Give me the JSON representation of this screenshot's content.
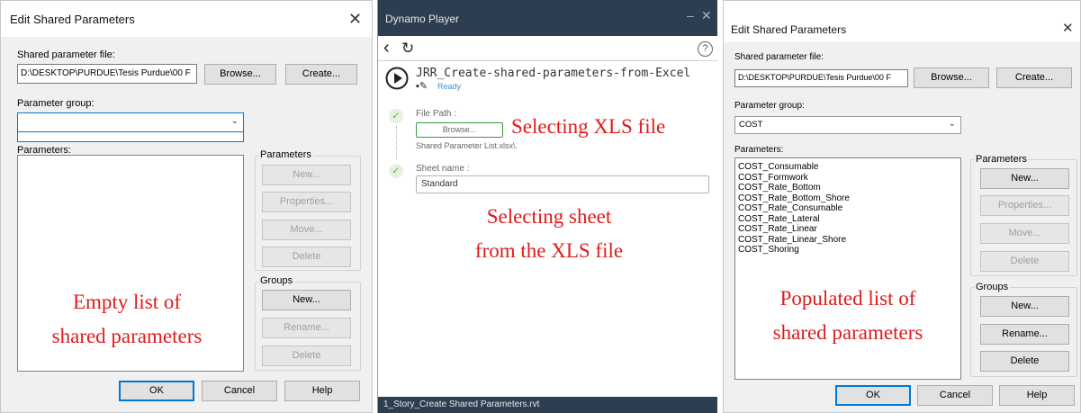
{
  "left_dialog": {
    "title": "Edit Shared Parameters",
    "shared_file_label": "Shared parameter file:",
    "shared_file_value": "D:\\DESKTOP\\PURDUE\\Tesis Purdue\\00 F",
    "browse_label": "Browse...",
    "create_label": "Create...",
    "param_group_label": "Parameter group:",
    "param_group_value": "",
    "parameters_label": "Parameters:",
    "params_group_title": "Parameters",
    "new_label": "New...",
    "properties_label": "Properties...",
    "move_label": "Move...",
    "delete_label": "Delete",
    "groups_title": "Groups",
    "groups_new_label": "New...",
    "rename_label": "Rename...",
    "groups_delete_label": "Delete",
    "ok_label": "OK",
    "cancel_label": "Cancel",
    "help_label": "Help",
    "annotation_line1": "Empty list of",
    "annotation_line2": "shared parameters"
  },
  "dynamo": {
    "title": "Dynamo Player",
    "script_name": "JRR_Create-shared-parameters-from-Excel",
    "status": "Ready",
    "help_glyph": "?",
    "file_path_label": "File Path :",
    "browse_label": "Browse...",
    "file_value": "Shared Parameter List.xlsx\\.",
    "sheet_name_label": "Sheet name :",
    "sheet_value": "Standard",
    "annotation_xls": "Selecting XLS file",
    "annotation_sheet_line1": "Selecting sheet",
    "annotation_sheet_line2": "from the XLS file",
    "footer": "1_Story_Create Shared Parameters.rvt"
  },
  "right_dialog": {
    "title": "Edit Shared Parameters",
    "shared_file_label": "Shared parameter file:",
    "shared_file_value": "D:\\DESKTOP\\PURDUE\\Tesis Purdue\\00 F",
    "browse_label": "Browse...",
    "create_label": "Create...",
    "param_group_label": "Parameter group:",
    "param_group_value": "COST",
    "parameters_label": "Parameters:",
    "parameter_items": [
      "COST_Consumable",
      "COST_Formwork",
      "COST_Rate_Bottom",
      "COST_Rate_Bottom_Shore",
      "COST_Rate_Consumable",
      "COST_Rate_Lateral",
      "COST_Rate_Linear",
      "COST_Rate_Linear_Shore",
      "COST_Shoring"
    ],
    "params_group_title": "Parameters",
    "new_label": "New...",
    "properties_label": "Properties...",
    "move_label": "Move...",
    "delete_label": "Delete",
    "groups_title": "Groups",
    "groups_new_label": "New...",
    "rename_label": "Rename...",
    "groups_delete_label": "Delete",
    "ok_label": "OK",
    "cancel_label": "Cancel",
    "help_label": "Help",
    "annotation_line1": "Populated list of",
    "annotation_line2": "shared parameters"
  }
}
